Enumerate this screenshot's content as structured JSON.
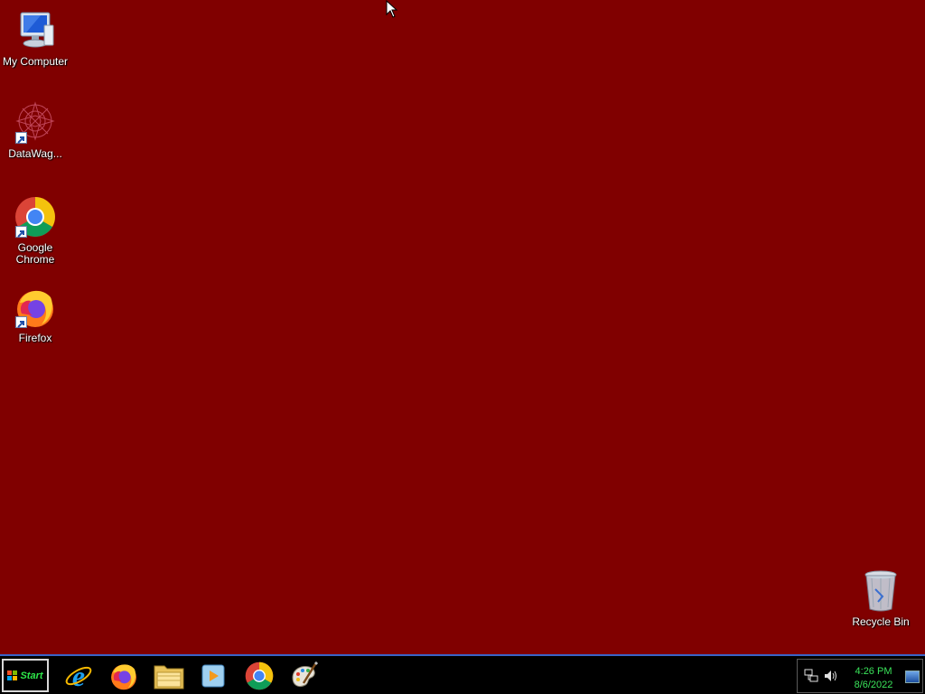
{
  "desktop": {
    "icons": [
      {
        "id": "my-computer",
        "label": "My Computer",
        "icon": "computer-icon"
      },
      {
        "id": "datawag",
        "label": "DataWag...",
        "icon": "datawag-icon"
      },
      {
        "id": "google-chrome",
        "label": "Google\nChrome",
        "icon": "chrome-icon"
      },
      {
        "id": "firefox",
        "label": "Firefox",
        "icon": "firefox-icon"
      },
      {
        "id": "recycle-bin",
        "label": "Recycle Bin",
        "icon": "recycle-bin-icon"
      }
    ],
    "background_color": "#800000"
  },
  "taskbar": {
    "start_label": "Start",
    "apps": [
      {
        "name": "Internet Explorer",
        "icon": "internet-explorer-icon"
      },
      {
        "name": "Firefox",
        "icon": "firefox-icon"
      },
      {
        "name": "File Explorer",
        "icon": "folder-icon"
      },
      {
        "name": "Media Player",
        "icon": "media-player-icon"
      },
      {
        "name": "Google Chrome",
        "icon": "chrome-icon"
      },
      {
        "name": "Paint",
        "icon": "paint-icon"
      }
    ],
    "tray": {
      "time": "4:26 PM",
      "date": "8/6/2022",
      "icons": [
        "network-icon",
        "volume-icon",
        "show-desktop-icon"
      ]
    },
    "accent_color": "#3a64c8",
    "clock_color": "#3ae35a"
  }
}
